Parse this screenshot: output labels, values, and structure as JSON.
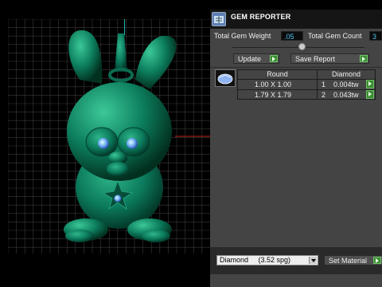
{
  "panel": {
    "title": "GEM REPORTER",
    "icon": "gem-reporter-icon",
    "total_gem_weight_label": "Total Gem Weight",
    "total_gem_weight_value": ".05",
    "total_gem_count_label": "Total Gem Count",
    "total_gem_count_value": "3",
    "update_button": "Update",
    "save_report_button": "Save Report",
    "table": {
      "headers": [
        "Round",
        "Diamond"
      ],
      "rows": [
        {
          "size": "1.00 X 1.00",
          "count": "1",
          "weight": "0.004tw"
        },
        {
          "size": "1.79 X 1.79",
          "count": "2",
          "weight": "0.043tw"
        }
      ]
    },
    "material_select": "Diamond     (3.52 spg)",
    "set_material_button": "Set Material"
  },
  "colors": {
    "model": "#0b7a5c",
    "panel_bg": "#444444",
    "value_text": "#4ec3f0",
    "go_button": "#3c8c35"
  }
}
